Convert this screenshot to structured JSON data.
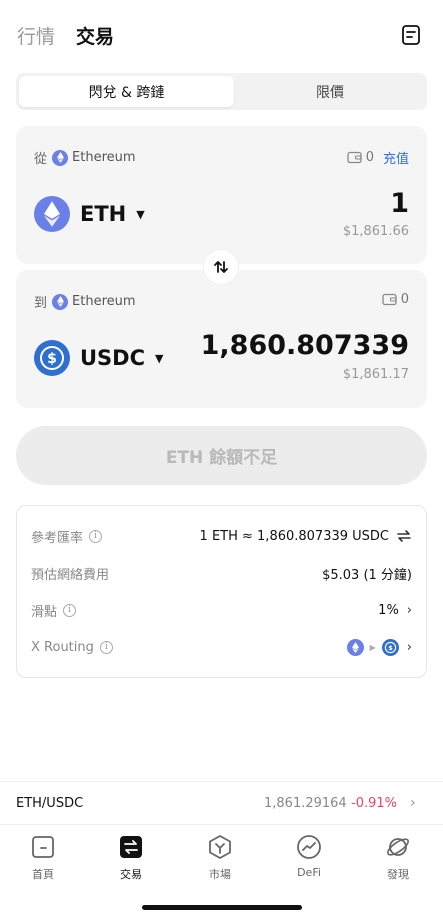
{
  "header": {
    "tabs": [
      {
        "label": "行情",
        "active": false
      },
      {
        "label": "交易",
        "active": true
      }
    ],
    "history_icon": "order-history-icon"
  },
  "mode_switch": {
    "options": [
      "閃兌 & 跨鏈",
      "限價"
    ],
    "selected": "閃兌 & 跨鏈"
  },
  "from": {
    "direction_label": "從",
    "network": "Ethereum",
    "balance": "0",
    "deposit_label": "充值",
    "token": "ETH",
    "amount": "1",
    "fiat_value": "$1,861.66"
  },
  "to": {
    "direction_label": "到",
    "network": "Ethereum",
    "balance": "0",
    "token": "USDC",
    "amount": "1,860.807339",
    "fiat_value": "$1,861.17"
  },
  "action_button": {
    "label": "ETH 餘額不足",
    "enabled": false
  },
  "details": {
    "rate_label": "參考匯率",
    "rate_value": "1 ETH ≈ 1,860.807339 USDC",
    "fee_label": "預估網絡費用",
    "fee_value": "$5.03 (1 分鐘)",
    "slippage_label": "滑點",
    "slippage_value": "1%",
    "routing_label": "X Routing"
  },
  "pair_bar": {
    "pair": "ETH/USDC",
    "price": "1,861.29164",
    "change": "-0.91%"
  },
  "tabbar": {
    "items": [
      {
        "label": "首頁",
        "icon": "home-icon",
        "active": false
      },
      {
        "label": "交易",
        "icon": "trade-icon",
        "active": true
      },
      {
        "label": "市場",
        "icon": "market-icon",
        "active": false
      },
      {
        "label": "DeFi",
        "icon": "defi-icon",
        "active": false
      },
      {
        "label": "發現",
        "icon": "discover-icon",
        "active": false
      }
    ]
  },
  "colors": {
    "accent_blue": "#2f6fe8",
    "eth_purple": "#6b7fe8",
    "usdc_blue": "#2f6fcf",
    "negative_red": "#e8475f",
    "disabled_button": "#ececec"
  }
}
